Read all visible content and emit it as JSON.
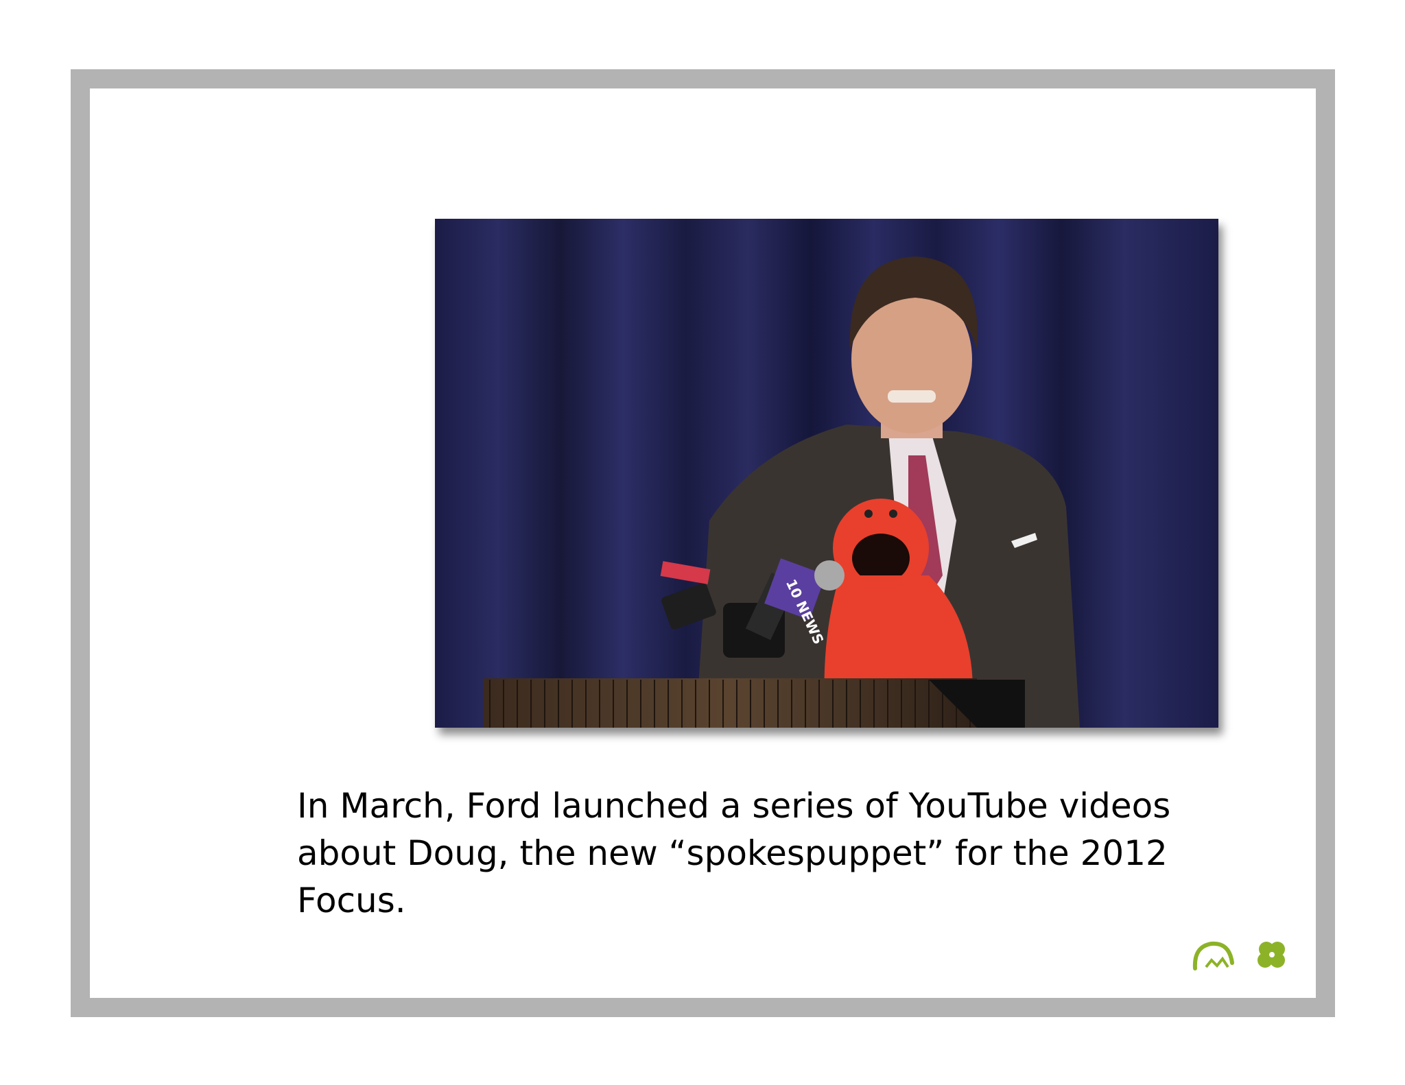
{
  "caption": {
    "text": "In March, Ford launched a series of YouTube videos about Doug, the new “spokespuppet” for the 2012 Focus."
  },
  "video_still": {
    "description_icon": "press-conference-photo",
    "mic_flag_text": "10 NEWS"
  },
  "logos": {
    "arch_icon": "arch-logo-icon",
    "clover_icon": "clover-logo-icon",
    "accent_color": "#8cb328"
  },
  "colors": {
    "frame": "#b3b3b3",
    "curtain": "#1f2050",
    "puppet": "#e8402c"
  }
}
